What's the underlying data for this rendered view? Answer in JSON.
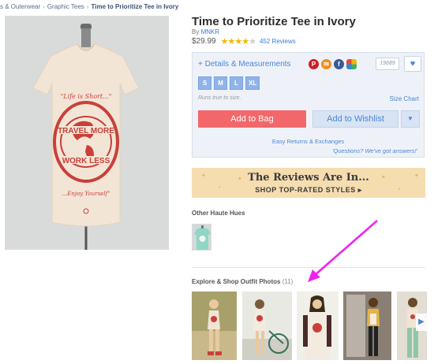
{
  "breadcrumb": {
    "items": [
      "s & Outerwear",
      "Graphic Tees",
      "Time to Prioritize Tee in Ivory"
    ],
    "separator": "›"
  },
  "product": {
    "title": "Time to Prioritize Tee in Ivory",
    "by_label": "By",
    "brand": "MNKR",
    "price": "$29.99",
    "rating_stars": 4,
    "rating_max": 5,
    "reviews": "452 Reviews"
  },
  "details": {
    "link": "+ Details & Measurements",
    "share_icons": [
      "pinterest-icon",
      "email-icon",
      "facebook-icon",
      "share-multi-icon"
    ],
    "wish_count": "19689",
    "sizes": [
      "S",
      "M",
      "L",
      "XL"
    ],
    "fit_note": "Runs true to size.",
    "size_chart": "Size Chart",
    "add_to_bag": "Add to Bag",
    "add_to_wishlist": "Add to Wishlist",
    "returns": "Easy Returns & Exchanges",
    "questions": "'Questions? We've got answers!'"
  },
  "banner": {
    "title": "The Reviews Are In...",
    "subtitle": "SHOP TOP-RATED STYLES ▸"
  },
  "other_hues": {
    "heading": "Other Haute Hues"
  },
  "outfits": {
    "heading": "Explore & Shop Outfit Photos",
    "count": "(11)"
  },
  "colors": {
    "accent_blue": "#4a85d6",
    "bag_red": "#f2676a",
    "annotation_arrow": "#ee22ee",
    "star": "#f5b400"
  }
}
